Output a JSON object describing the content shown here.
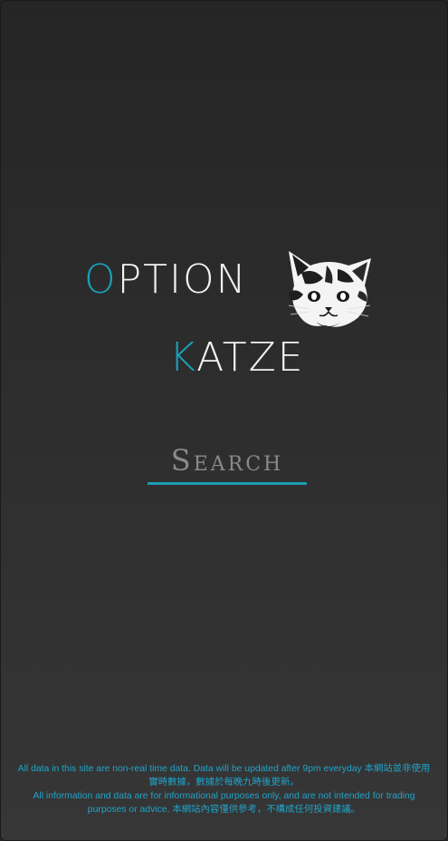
{
  "logo": {
    "line1_initial": "O",
    "line1_rest": "PTION",
    "line2_initial": "K",
    "line2_rest": "ATZE",
    "cat_image": "cat-face-logo",
    "accent_color": "#1aa0b8",
    "text_color": "#f2f2f2"
  },
  "search": {
    "placeholder": "Search",
    "value": "",
    "underline_color": "#1c9bb2"
  },
  "disclaimer": {
    "line1": "All data in this site are non-real time data. Data will be updated after 9pm everyday 本網站並非使用實時數據，數據於每晚九時後更新。",
    "line2": "All information and data are for informational purposes only, and are not intended for trading purposes or advice. 本網站內容僅供參考，不構成任何投資建議。",
    "color": "#21a3c9"
  }
}
